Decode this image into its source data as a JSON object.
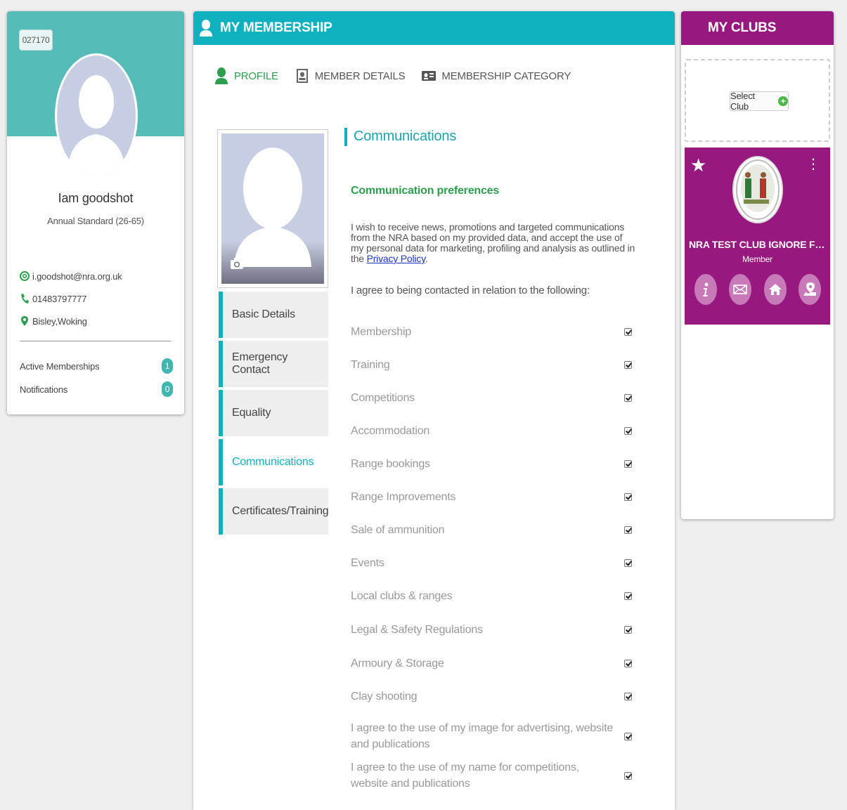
{
  "profile": {
    "member_number": "027170",
    "name": "Iam goodshot",
    "category": "Annual Standard (26-65)",
    "email": "i.goodshot@nra.org.uk",
    "phone": "01483797777",
    "location": "Bisley,Woking",
    "stats": [
      {
        "label": "Active Memberships",
        "count": "1"
      },
      {
        "label": "Notifications",
        "count": "0"
      }
    ]
  },
  "main": {
    "header_title": "MY MEMBERSHIP",
    "tabs": [
      {
        "label": "PROFILE",
        "icon": "person-icon",
        "active": true
      },
      {
        "label": "MEMBER DETAILS",
        "icon": "id-badge-icon"
      },
      {
        "label": "MEMBERSHIP CATEGORY",
        "icon": "id-card-icon"
      }
    ],
    "side_nav": [
      {
        "label": "Basic Details"
      },
      {
        "label": "Emergency Contact"
      },
      {
        "label": "Equality"
      },
      {
        "label": "Communications",
        "active": true
      },
      {
        "label": "Certificates/Training"
      }
    ],
    "section_title": "Communications",
    "sub_title": "Communication preferences",
    "intro_text": "I wish to receive news, promotions and targeted communications from the NRA based on my provided data, and accept the use of my personal data for marketing, profiling and analysis as outlined in the ",
    "privacy_link": "Privacy Policy",
    "intro_end": ".",
    "agree_text": "I agree to being contacted in relation to the following:",
    "preferences": [
      {
        "label": "Membership",
        "checked": true
      },
      {
        "label": "Training",
        "checked": true
      },
      {
        "label": "Competitions",
        "checked": true
      },
      {
        "label": "Accommodation",
        "checked": true
      },
      {
        "label": "Range bookings",
        "checked": true
      },
      {
        "label": "Range Improvements",
        "checked": true
      },
      {
        "label": "Sale of ammunition",
        "checked": true
      },
      {
        "label": "Events",
        "checked": true
      },
      {
        "label": "Local clubs & ranges",
        "checked": true
      },
      {
        "label": "Legal & Safety Regulations",
        "checked": true
      },
      {
        "label": "Armoury & Storage",
        "checked": true
      },
      {
        "label": "Clay shooting",
        "checked": true
      },
      {
        "label": "I agree to the use of my image for advertising, website and publications",
        "checked": true
      },
      {
        "label": "I agree to the use of my name for competitions, website and publications",
        "checked": true
      }
    ]
  },
  "clubs": {
    "header_title": "MY CLUBS",
    "select_label": "Select Club",
    "club_name": "NRA TEST CLUB IGNORE FOR ST...",
    "club_role": "Member",
    "actions": [
      "info-icon",
      "mail-icon",
      "home-icon",
      "location-icon"
    ]
  },
  "colors": {
    "teal": "#0fb1bf",
    "left_teal": "#55bcb8",
    "green": "#2e9d4f",
    "purple": "#97197f"
  }
}
